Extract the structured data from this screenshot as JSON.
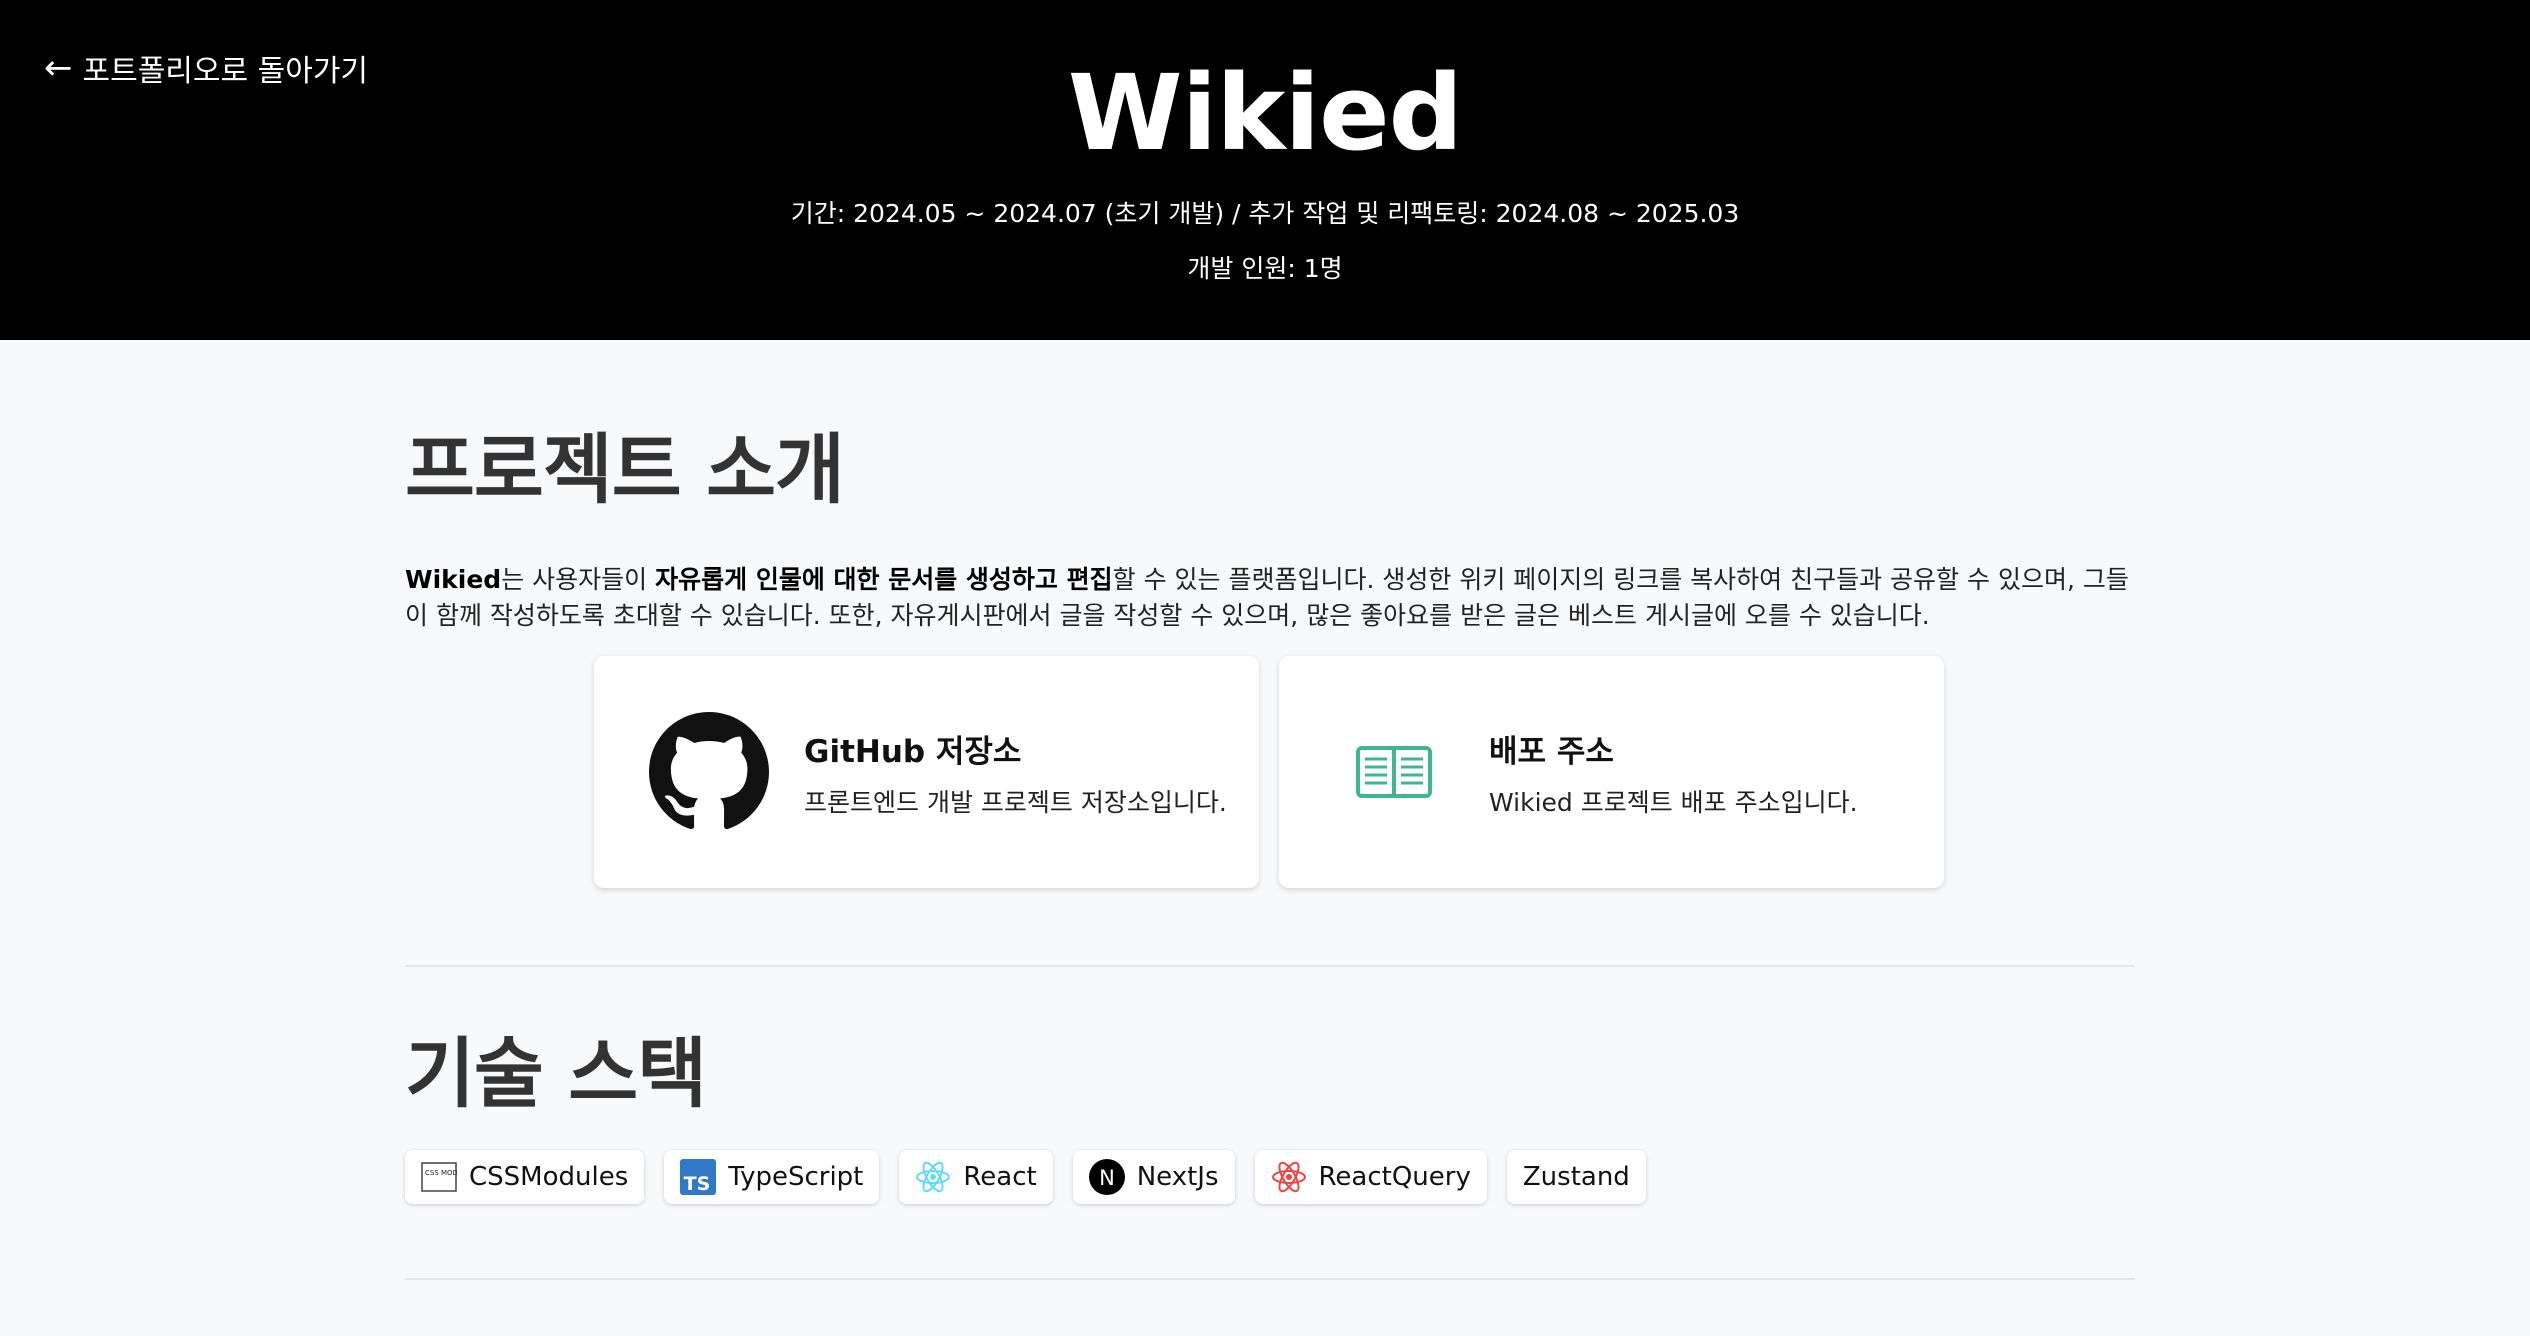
{
  "header": {
    "back_label": "포트폴리오로 돌아가기",
    "title": "Wikied",
    "period": "기간: 2024.05 ~ 2024.07 (초기 개발) / 추가 작업 및 리팩토링: 2024.08 ~ 2025.03",
    "members": "개발 인원: 1명"
  },
  "intro": {
    "title": "프로젝트 소개",
    "text_parts": [
      "Wikied",
      "는 사용자들이 ",
      "자유롭게 인물에 대한 문서를 생성하고 편집",
      "할 수 있는 플랫폼입니다. 생성한 위키 페이지의 링크를 복사하여 친구들과 공유할 수 있으며, 그들이 함께 작성하도록 초대할 수 있습니다. 또한, 자유게시판에서 글을 작성할 수 있으며, 많은 좋아요를 받은 글은 베스트 게시글에 오를 수 있습니다."
    ]
  },
  "cards": [
    {
      "icon": "github-icon",
      "title": "GitHub 저장소",
      "desc": "프론트엔드 개발 프로젝트 저장소입니다."
    },
    {
      "icon": "book-icon",
      "title": "배포 주소",
      "desc": "Wikied 프로젝트 배포 주소입니다."
    }
  ],
  "stack": {
    "title": "기술 스택",
    "items": [
      {
        "icon": "css-modules-icon",
        "label": "CSSModules",
        "icon_text": "CSS MODULES"
      },
      {
        "icon": "typescript-icon",
        "label": "TypeScript",
        "icon_text": "TS"
      },
      {
        "icon": "react-icon",
        "label": "React"
      },
      {
        "icon": "nextjs-icon",
        "label": "NextJs",
        "icon_text": "N"
      },
      {
        "icon": "react-query-icon",
        "label": "ReactQuery"
      },
      {
        "icon": "",
        "label": "Zustand"
      }
    ]
  },
  "colors": {
    "header_bg": "#000000",
    "page_bg": "#f8f9fa",
    "typescript_blue": "#3178c6",
    "react_cyan": "#61dafb",
    "react_query_red": "#ef4444",
    "book_green": "#3fb68b"
  }
}
